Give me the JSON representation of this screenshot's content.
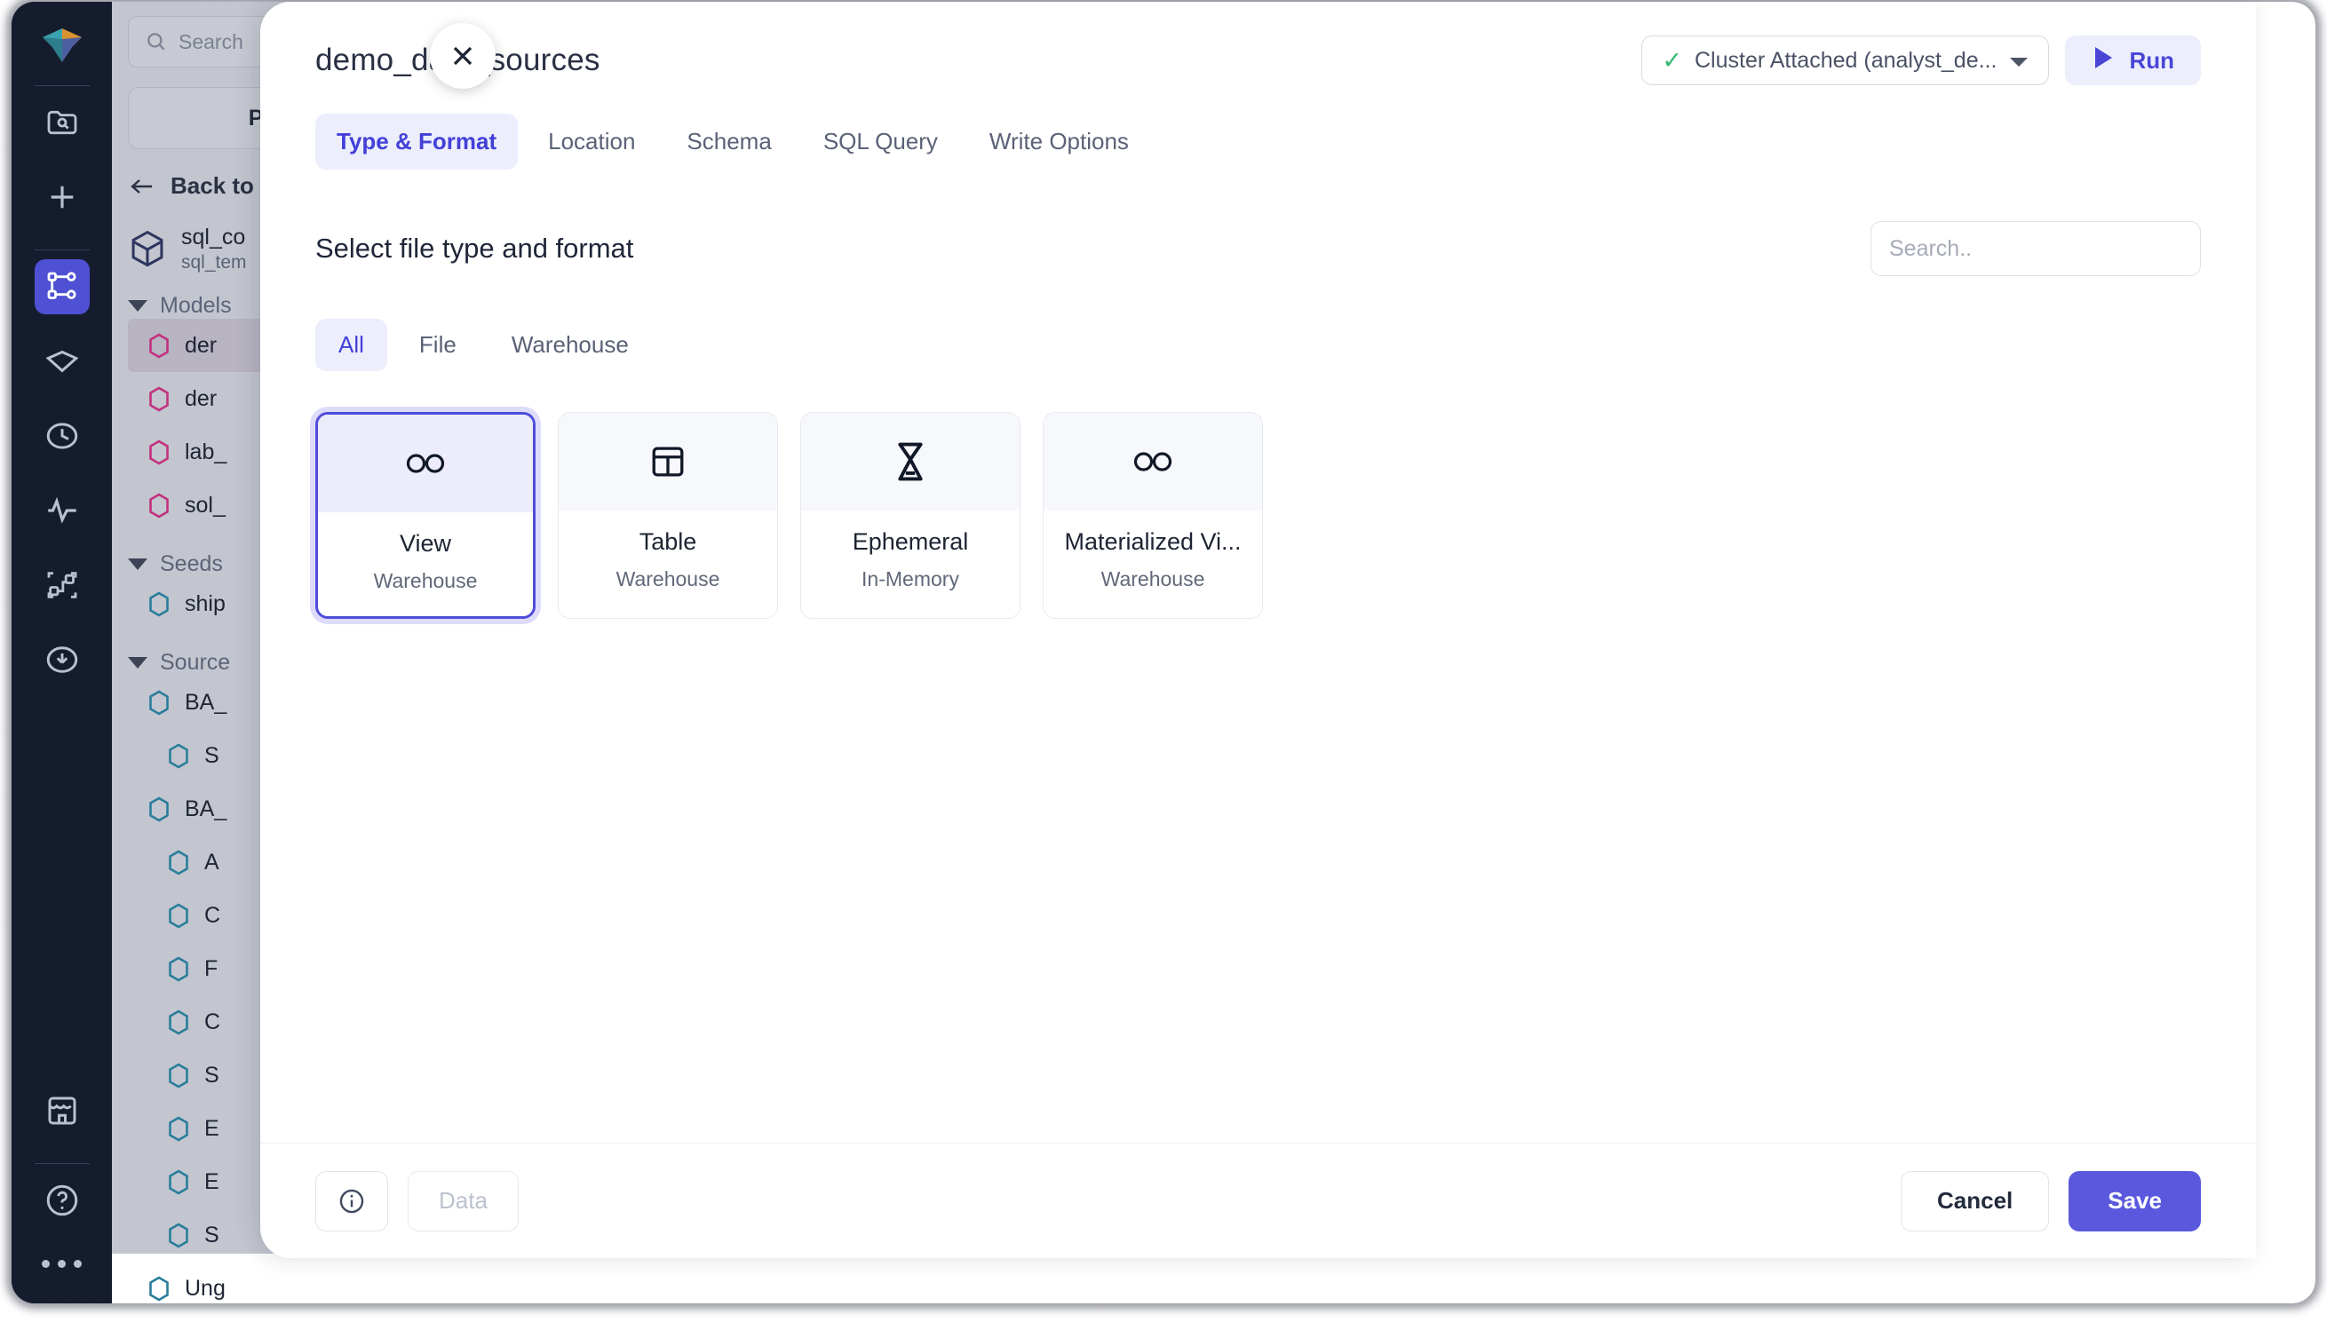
{
  "app": {
    "rail": {
      "logo_icon": "cube-logo-icon",
      "items": [
        {
          "icon": "folder-search-icon",
          "name": "browse",
          "active": false
        },
        {
          "icon": "plus-icon",
          "name": "new",
          "active": false
        },
        {
          "icon": "graph-nodes-icon",
          "name": "lineage",
          "active": true
        },
        {
          "icon": "gem-icon",
          "name": "assets",
          "active": false
        },
        {
          "icon": "clock-icon",
          "name": "history",
          "active": false
        },
        {
          "icon": "activity-icon",
          "name": "monitoring",
          "active": false
        },
        {
          "icon": "workflow-icon",
          "name": "workflows",
          "active": false
        },
        {
          "icon": "download-circle-icon",
          "name": "downloads",
          "active": false
        }
      ],
      "bottom_items": [
        {
          "icon": "store-icon",
          "name": "marketplace"
        },
        {
          "icon": "help-circle-icon",
          "name": "help"
        },
        {
          "icon": "more-dots-icon",
          "name": "more"
        }
      ]
    },
    "tree": {
      "search_placeholder": "Search",
      "projects_label": "Proje",
      "back_label": "Back to",
      "project_name": "sql_co",
      "project_sub": "sql_tem",
      "groups": [
        {
          "label": "Models",
          "items": [
            {
              "label": "der",
              "color": "#c2317e",
              "indent": 0,
              "selected": true
            },
            {
              "label": "der",
              "color": "#c2317e",
              "indent": 0,
              "selected": false
            },
            {
              "label": "lab_",
              "color": "#c2317e",
              "indent": 0,
              "selected": false
            },
            {
              "label": "sol_",
              "color": "#c2317e",
              "indent": 0,
              "selected": false
            }
          ]
        },
        {
          "label": "Seeds",
          "items": [
            {
              "label": "ship",
              "color": "#2a7d9b",
              "indent": 0,
              "selected": false
            }
          ]
        },
        {
          "label": "Source",
          "items": [
            {
              "label": "BA_",
              "color": "#2a7d9b",
              "indent": 0,
              "selected": false
            },
            {
              "label": "S",
              "color": "#2a7d9b",
              "indent": 1,
              "selected": false
            },
            {
              "label": "BA_",
              "color": "#2a7d9b",
              "indent": 0,
              "selected": false
            },
            {
              "label": "A",
              "color": "#2a7d9b",
              "indent": 1,
              "selected": false
            },
            {
              "label": "C",
              "color": "#2a7d9b",
              "indent": 1,
              "selected": false
            },
            {
              "label": "F",
              "color": "#2a7d9b",
              "indent": 1,
              "selected": false
            },
            {
              "label": "C",
              "color": "#2a7d9b",
              "indent": 1,
              "selected": false
            },
            {
              "label": "S",
              "color": "#2a7d9b",
              "indent": 1,
              "selected": false
            },
            {
              "label": "E",
              "color": "#2a7d9b",
              "indent": 1,
              "selected": false
            },
            {
              "label": "E",
              "color": "#2a7d9b",
              "indent": 1,
              "selected": false
            },
            {
              "label": "S",
              "color": "#2a7d9b",
              "indent": 1,
              "selected": false
            },
            {
              "label": "Ung",
              "color": "#2a7d9b",
              "indent": 0,
              "selected": false
            }
          ]
        }
      ]
    }
  },
  "modal": {
    "close_icon": "close-icon",
    "title": "demo_data_sources",
    "cluster": {
      "status_icon": "check-icon",
      "label": "Cluster Attached (analyst_de...",
      "chevron_icon": "chevron-down-icon"
    },
    "run": {
      "icon": "play-icon",
      "label": "Run"
    },
    "tabs": [
      {
        "label": "Type & Format",
        "active": true
      },
      {
        "label": "Location",
        "active": false
      },
      {
        "label": "Schema",
        "active": false
      },
      {
        "label": "SQL Query",
        "active": false
      },
      {
        "label": "Write Options",
        "active": false
      }
    ],
    "section_title": "Select file type and format",
    "search": {
      "placeholder": "Search..",
      "value": "",
      "icon": "search-icon"
    },
    "filters": [
      {
        "label": "All",
        "active": true
      },
      {
        "label": "File",
        "active": false
      },
      {
        "label": "Warehouse",
        "active": false
      }
    ],
    "cards": [
      {
        "name": "View",
        "sub": "Warehouse",
        "icon": "view-glasses-icon",
        "selected": true
      },
      {
        "name": "Table",
        "sub": "Warehouse",
        "icon": "table-grid-icon",
        "selected": false
      },
      {
        "name": "Ephemeral",
        "sub": "In-Memory",
        "icon": "hourglass-icon",
        "selected": false
      },
      {
        "name": "Materialized Vi...",
        "sub": "Warehouse",
        "icon": "view-glasses-icon",
        "selected": false
      }
    ],
    "footer": {
      "info_icon": "info-icon",
      "data_label": "Data",
      "cancel_label": "Cancel",
      "save_label": "Save"
    }
  },
  "colors": {
    "accent": "#4f4ddb",
    "accent_soft": "#eceefc",
    "rail_bg": "#151c2e",
    "success": "#2eb872",
    "save_bg": "#5a59dd"
  }
}
